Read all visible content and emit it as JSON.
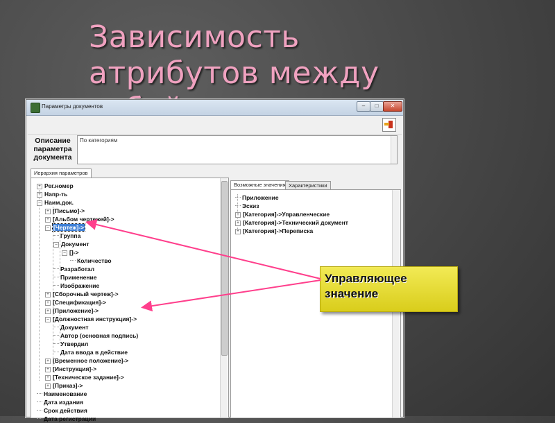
{
  "slide": {
    "title": "Зависимость атрибутов между собой"
  },
  "window": {
    "title": "Параметры документов",
    "controls": {
      "minimize": "–",
      "maximize": "□",
      "close": "✕"
    }
  },
  "description": {
    "label": "Описание параметра документа",
    "value": "По категориям"
  },
  "left_panel": {
    "tab": "Иерархия параметров",
    "tree": [
      {
        "text": "Рег.номер"
      },
      {
        "text": "Напр-ть"
      },
      {
        "text": "Наим.док."
      },
      {
        "text": "[Письмо]->"
      },
      {
        "text": "[Альбом чертежей]->"
      },
      {
        "text": "[Чертеж]->"
      },
      {
        "text": "Группа"
      },
      {
        "text": "Документ"
      },
      {
        "text": "[]->"
      },
      {
        "text": "Количество"
      },
      {
        "text": "Разработал"
      },
      {
        "text": "Применение"
      },
      {
        "text": "Изображение"
      },
      {
        "text": "[Сборочный чертеж]->"
      },
      {
        "text": "[Спецификация]->"
      },
      {
        "text": "[Приложение]->"
      },
      {
        "text": "[Должностная инструкция]->"
      },
      {
        "text": "Документ"
      },
      {
        "text": "Автор (основная подпись)"
      },
      {
        "text": "Утвердил"
      },
      {
        "text": "Дата ввода в действие"
      },
      {
        "text": "[Временное положение]->"
      },
      {
        "text": "[Инструкция]->"
      },
      {
        "text": "[Техническое задание]->"
      },
      {
        "text": "[Приказ]->"
      },
      {
        "text": "Наименование"
      },
      {
        "text": "Дата издания"
      },
      {
        "text": "Срок действия"
      },
      {
        "text": "Дата регистрации"
      }
    ]
  },
  "right_panel": {
    "tabs": [
      "Возможные значения",
      "Характеристики"
    ],
    "tree": [
      {
        "text": "Приложение"
      },
      {
        "text": "Эскиз"
      },
      {
        "text": "[Категория]->Управленческие"
      },
      {
        "text": "[Категория]->Технический документ"
      },
      {
        "text": "[Категория]->Переписка"
      }
    ]
  },
  "callout": {
    "text": "Управляющее значение"
  },
  "colors": {
    "title": "#f0a2c0",
    "callout": "#e6dc30",
    "arrow": "#ff3f8c",
    "selection": "#3e7fd5"
  }
}
